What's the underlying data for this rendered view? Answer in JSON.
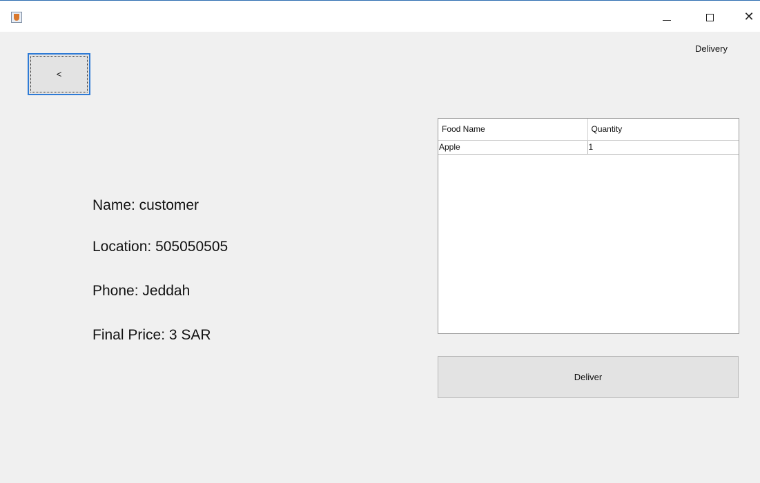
{
  "window": {
    "label": "Delivery",
    "controls": {
      "minimize": "",
      "maximize": "",
      "close": "✕"
    }
  },
  "back_button": {
    "label": "<"
  },
  "order": {
    "name": "Name: customer",
    "location": "Location: 505050505",
    "phone": "Phone: Jeddah",
    "final_price": "Final Price: 3 SAR"
  },
  "table": {
    "columns": [
      "Food Name",
      "Quantity"
    ],
    "rows": [
      {
        "food": "Apple",
        "quantity": "1"
      }
    ]
  },
  "deliver_button": {
    "label": "Deliver"
  }
}
